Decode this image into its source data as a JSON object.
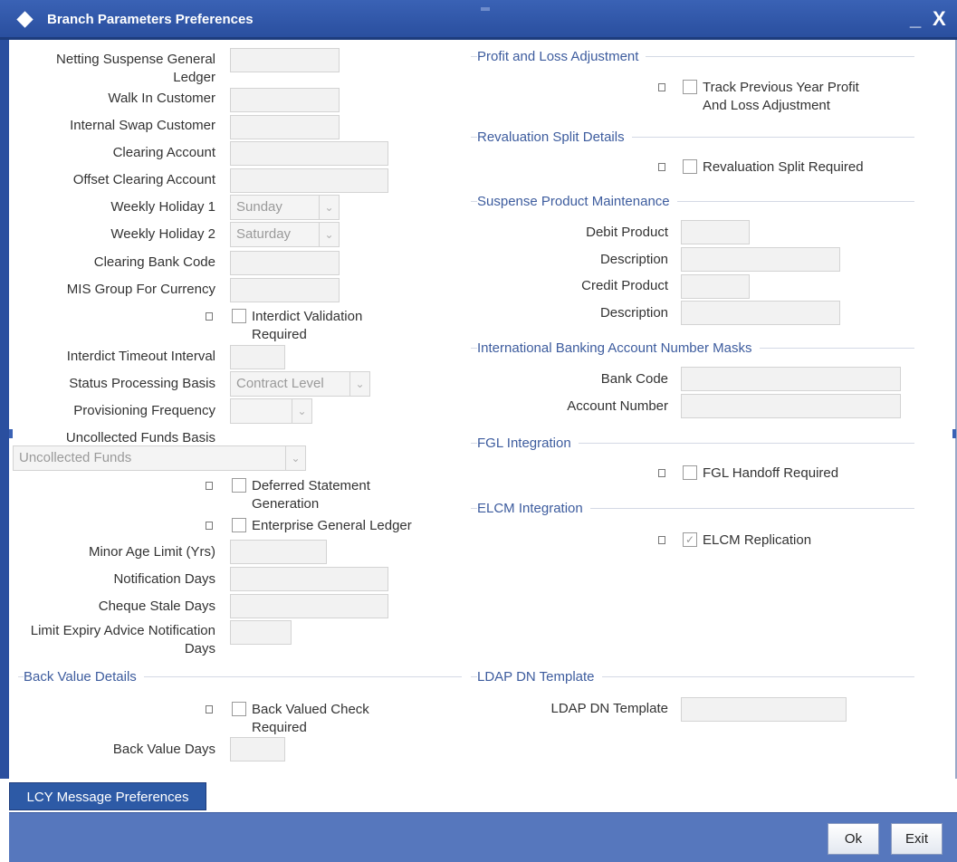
{
  "window": {
    "title": "Branch Parameters Preferences",
    "minimize": "_",
    "close": "X"
  },
  "left": {
    "netting_suspense_label": "Netting Suspense General",
    "netting_suspense_label2": "Ledger",
    "walk_in_customer_label": "Walk In Customer",
    "internal_swap_customer_label": "Internal Swap Customer",
    "clearing_account_label": "Clearing Account",
    "offset_clearing_account_label": "Offset Clearing Account",
    "weekly_holiday1_label": "Weekly Holiday 1",
    "weekly_holiday1_value": "Sunday",
    "weekly_holiday2_label": "Weekly Holiday 2",
    "weekly_holiday2_value": "Saturday",
    "clearing_bank_code_label": "Clearing Bank Code",
    "mis_group_label": "MIS Group For Currency",
    "interdict_validation_label": "Interdict Validation",
    "interdict_validation_label2": "Required",
    "interdict_timeout_label": "Interdict Timeout Interval",
    "status_processing_label": "Status Processing Basis",
    "status_processing_value": "Contract Level",
    "provisioning_frequency_label": "Provisioning Frequency",
    "provisioning_frequency_value": "",
    "uncollected_funds_basis_label": "Uncollected Funds Basis",
    "uncollected_funds_value": "Uncollected Funds",
    "deferred_statement_label": "Deferred Statement",
    "deferred_statement_label2": "Generation",
    "enterprise_gl_label": "Enterprise General Ledger",
    "minor_age_label": "Minor Age Limit (Yrs)",
    "notification_days_label": "Notification Days",
    "cheque_stale_label": "Cheque Stale Days",
    "limit_expiry_label": "Limit Expiry Advice Notification",
    "limit_expiry_label2": "Days",
    "back_value_section": "Back Value Details",
    "back_valued_check_label": "Back Valued Check",
    "back_valued_check_label2": "Required",
    "back_value_days_label": "Back Value Days"
  },
  "right": {
    "pl_section": "Profit and Loss Adjustment",
    "track_prev_label": "Track Previous Year Profit",
    "track_prev_label2": "And Loss Adjustment",
    "reval_section": "Revaluation Split Details",
    "reval_split_label": "Revaluation Split Required",
    "suspense_section": "Suspense Product Maintenance",
    "debit_product_label": "Debit Product",
    "description1_label": "Description",
    "credit_product_label": "Credit Product",
    "description2_label": "Description",
    "iban_section": "International Banking Account Number Masks",
    "bank_code_label": "Bank Code",
    "account_number_label": "Account Number",
    "fgl_section": "FGL Integration",
    "fgl_handoff_label": "FGL Handoff Required",
    "elcm_section": "ELCM Integration",
    "elcm_replication_label": "ELCM Replication",
    "elcm_replication_checked": true,
    "ldap_section": "LDAP DN Template",
    "ldap_template_label": "LDAP DN Template"
  },
  "footer": {
    "lcy_button": "LCY Message Preferences",
    "ok_button": "Ok",
    "exit_button": "Exit"
  }
}
